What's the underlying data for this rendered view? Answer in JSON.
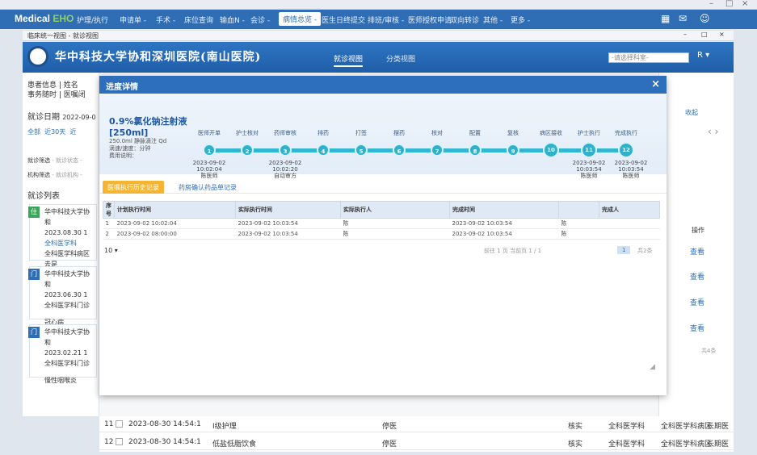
{
  "os_window": {
    "controls": [
      "–",
      "□",
      "×"
    ]
  },
  "app_nav": {
    "logo_main": "Medical",
    "logo_accent": "EHO",
    "items": [
      "护理/执行",
      "申请单 -",
      "手术 -",
      "床位查询",
      "输血N -",
      "会诊 -",
      "病情总览 -",
      "医生日终提交",
      "排班/审核 -",
      "医师授权申请",
      "双向转诊",
      "其他 -",
      "更多 -"
    ],
    "active_index": 6
  },
  "win2": {
    "title": "临床统一视图 - 就诊视图",
    "controls": [
      "–",
      "□",
      "×"
    ]
  },
  "hospital": {
    "name": "华中科技大学协和深圳医院(南山医院)",
    "tabs": [
      "就诊视图",
      "分类视图"
    ],
    "active_tab": 0,
    "ward_placeholder": "-请选择科室-",
    "user_initial": "R"
  },
  "bg_page": {
    "breadcrumb_1": "患者信息 | 姓名",
    "breadcrumb_2": "事务随时 | 医嘱闭",
    "visit_date_label": "就诊日期",
    "visit_date_value": "2022-09-0",
    "filter_all": "全部",
    "filter_30": "近30天",
    "filter_more": "近",
    "type_filter_label": "就诊筛选",
    "type_filter_value": "- 就诊状态 -",
    "org_filter_label": "机构筛选",
    "org_filter_value": "- 就诊机构 -",
    "list_title": "就诊列表",
    "patients": [
      {
        "badge": "住",
        "hospital": "华中科技大学协和",
        "date": "2023.08.30 1",
        "dept": "全科医学科",
        "ward": "全科医学科病区",
        "status": "去是"
      },
      {
        "badge": "门",
        "hospital": "华中科技大学协和",
        "date": "2023.06.30 1",
        "dept": "全科医学科门诊",
        "ward": "",
        "status": "冠心病"
      },
      {
        "badge": "门",
        "hospital": "华中科技大学协和",
        "date": "2023.02.21 1",
        "dept": "全科医学科门诊",
        "ward": "",
        "status": "慢性咽喉炎"
      }
    ],
    "right_collapse": "收起",
    "right_op_header": "操作",
    "right_view_label": "查看",
    "right_page_info": "共4条"
  },
  "modal": {
    "title": "进度详情",
    "close": "×",
    "drug_name": "0.9%氯化钠注射液 [250ml]",
    "drug_dose": "250.0ml 静脉滴注 Qd",
    "drug_route": "滴速/速度：分钟",
    "drug_note": "费用说明：",
    "steps": [
      {
        "num": "1",
        "label": "医师开单",
        "time": "2023-09-02",
        "time2": "10:02:04",
        "who": "陈医师"
      },
      {
        "num": "2",
        "label": "护士核对",
        "time": "",
        "time2": "",
        "who": ""
      },
      {
        "num": "3",
        "label": "药师审核",
        "time": "2023-09-02",
        "time2": "10:02:20",
        "who": "自动审方"
      },
      {
        "num": "4",
        "label": "排药",
        "time": "",
        "time2": "",
        "who": ""
      },
      {
        "num": "5",
        "label": "打签",
        "time": "",
        "time2": "",
        "who": ""
      },
      {
        "num": "6",
        "label": "摆药",
        "time": "",
        "time2": "",
        "who": ""
      },
      {
        "num": "7",
        "label": "核对",
        "time": "",
        "time2": "",
        "who": ""
      },
      {
        "num": "8",
        "label": "配置",
        "time": "",
        "time2": "",
        "who": ""
      },
      {
        "num": "9",
        "label": "复核",
        "time": "",
        "time2": "",
        "who": ""
      },
      {
        "num": "10",
        "label": "病区接收",
        "time": "",
        "time2": "",
        "who": ""
      },
      {
        "num": "11",
        "label": "护士执行",
        "time": "2023-09-02",
        "time2": "10:03:54",
        "who": "陈医师"
      },
      {
        "num": "12",
        "label": "完成执行",
        "time": "2023-09-02",
        "time2": "10:03:54",
        "who": "陈医师"
      }
    ],
    "tabs": [
      "医嘱执行历史记录",
      "药房确认药品单记录"
    ],
    "active_tab": 0,
    "table": {
      "headers": [
        "序号",
        "计划执行时间",
        "实际执行时间",
        "实际执行人",
        "完成时间",
        "",
        "完成人"
      ],
      "rows": [
        [
          "1",
          "2023-09-02 10:02:04",
          "2023-09-02 10:03:54",
          "陈",
          "2023-09-02 10:03:54",
          "陈",
          ""
        ],
        [
          "2",
          "2023-09-02 08:00:00",
          "2023-09-02 10:03:54",
          "陈",
          "2023-09-02 10:03:54",
          "陈",
          ""
        ]
      ]
    },
    "pager": {
      "page_size": "10 ▾",
      "info": "前往 1 页 当前页 1 / 1",
      "page": "1",
      "total": "共2条"
    }
  },
  "bottom_rows": [
    {
      "num": "11",
      "time": "2023-08-30 14:54:1",
      "item": "Ⅰ级护理",
      "status": "停医",
      "col4": "核实",
      "dept": "全科医学科",
      "ward": "全科医学科病区",
      "type": "长期医"
    },
    {
      "num": "12",
      "time": "2023-08-30 14:54:1",
      "item": "低盐低脂饮食",
      "status": "停医",
      "col4": "核实",
      "dept": "全科医学科",
      "ward": "全科医学科病区",
      "type": "长期医"
    }
  ],
  "colors": {
    "brand": "#2f6db5",
    "accent": "#f5b431",
    "timeline": "#2fb1cb"
  }
}
